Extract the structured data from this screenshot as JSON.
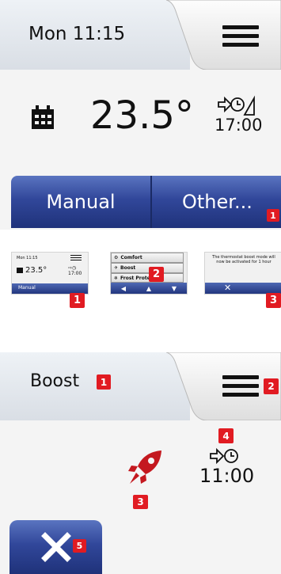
{
  "screen_main": {
    "datetime": "Mon 11:15",
    "temperature": "23.5°",
    "next_time": "17:00",
    "buttons": {
      "manual": "Manual",
      "other": "Other..."
    },
    "badges": {
      "other": "1"
    }
  },
  "thumbnails": [
    {
      "datetime": "Mon 11:15",
      "temperature": "23.5°",
      "button": "Manual",
      "badge": "1"
    },
    {
      "items": [
        "Comfort",
        "Boost",
        "Frost Protect"
      ],
      "badge": "2"
    },
    {
      "message": "The thermostat boost mode will now be activated for 1 hour",
      "badge": "3"
    }
  ],
  "screen_boost": {
    "title": "Boost",
    "end_time": "11:00",
    "badges": {
      "title": "1",
      "menu": "2",
      "rocket": "3",
      "time": "4",
      "cancel": "5"
    }
  },
  "colors": {
    "button_blue": "#2c4290",
    "badge_red": "#e11b22"
  },
  "icons": [
    "calendar-icon",
    "menu-icon",
    "next-schedule-icon",
    "rocket-icon",
    "close-icon"
  ]
}
